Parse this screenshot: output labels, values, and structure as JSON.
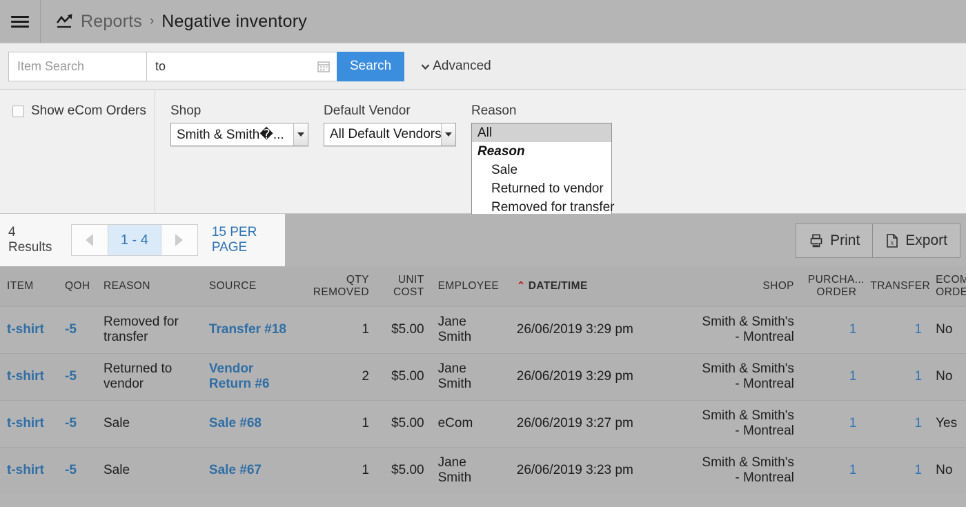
{
  "header": {
    "menu_icon": "hamburger-icon",
    "report_icon": "line-chart-icon",
    "breadcrumb_root": "Reports",
    "breadcrumb_sep": "›",
    "breadcrumb_current": "Negative inventory"
  },
  "search": {
    "item_placeholder": "Item Search",
    "item_value": "",
    "date_value": "to",
    "date_icon": "calendar-icon",
    "search_label": "Search",
    "advanced_label": "Advanced",
    "advanced_icon": "chevron-down-icon"
  },
  "filters": {
    "ecom_checkbox_label": "Show eCom Orders",
    "ecom_checked": false,
    "shop": {
      "label": "Shop",
      "value": "Smith & Smith�..."
    },
    "vendor": {
      "label": "Default Vendor",
      "value": "All Default Vendors"
    },
    "reason": {
      "label": "Reason",
      "selected": "All",
      "group_label": "Reason",
      "options": [
        "Sale",
        "Returned to vendor",
        "Removed for transfer"
      ]
    }
  },
  "toolbar": {
    "results_count": "4 Results",
    "prev_icon": "triangle-left-icon",
    "page_range": "1 - 4",
    "next_icon": "triangle-right-icon",
    "per_page": "15 PER PAGE",
    "print_label": "Print",
    "print_icon": "printer-icon",
    "export_label": "Export",
    "export_icon": "spreadsheet-file-icon"
  },
  "table": {
    "sort_column": "DATE/TIME",
    "sort_direction": "asc",
    "sort_caret": "⌃",
    "columns": [
      {
        "key": "item",
        "label": "ITEM",
        "align": "left"
      },
      {
        "key": "qoh",
        "label": "QOH",
        "align": "left"
      },
      {
        "key": "reason",
        "label": "REASON",
        "align": "left"
      },
      {
        "key": "source",
        "label": "SOURCE",
        "align": "left"
      },
      {
        "key": "qty_removed",
        "label": "QTY REMOVED",
        "align": "right"
      },
      {
        "key": "unit_cost",
        "label": "UNIT COST",
        "align": "right"
      },
      {
        "key": "employee",
        "label": "EMPLOYEE",
        "align": "left"
      },
      {
        "key": "datetime",
        "label": "DATE/TIME",
        "align": "left"
      },
      {
        "key": "shop",
        "label": "SHOP",
        "align": "right"
      },
      {
        "key": "purchase_order",
        "label": "PURCHA... ORDER",
        "align": "right"
      },
      {
        "key": "transfer",
        "label": "TRANSFER",
        "align": "right"
      },
      {
        "key": "ecom_order",
        "label": "ECOM ORDER",
        "align": "left"
      }
    ],
    "rows": [
      {
        "item": "t-shirt",
        "qoh": "-5",
        "reason": "Removed for transfer",
        "source": "Transfer #18",
        "qty_removed": "1",
        "unit_cost": "$5.00",
        "employee": "Jane Smith",
        "datetime": "26/06/2019 3:29 pm",
        "shop": "Smith & Smith's - Montreal",
        "purchase_order": "1",
        "transfer": "1",
        "ecom_order": "No"
      },
      {
        "item": "t-shirt",
        "qoh": "-5",
        "reason": "Returned to vendor",
        "source": "Vendor Return #6",
        "qty_removed": "2",
        "unit_cost": "$5.00",
        "employee": "Jane Smith",
        "datetime": "26/06/2019 3:29 pm",
        "shop": "Smith & Smith's - Montreal",
        "purchase_order": "1",
        "transfer": "1",
        "ecom_order": "No"
      },
      {
        "item": "t-shirt",
        "qoh": "-5",
        "reason": "Sale",
        "source": "Sale #68",
        "qty_removed": "1",
        "unit_cost": "$5.00",
        "employee": "eCom",
        "datetime": "26/06/2019 3:27 pm",
        "shop": "Smith & Smith's - Montreal",
        "purchase_order": "1",
        "transfer": "1",
        "ecom_order": "Yes"
      },
      {
        "item": "t-shirt",
        "qoh": "-5",
        "reason": "Sale",
        "source": "Sale #67",
        "qty_removed": "1",
        "unit_cost": "$5.00",
        "employee": "Jane Smith",
        "datetime": "26/06/2019 3:23 pm",
        "shop": "Smith & Smith's - Montreal",
        "purchase_order": "1",
        "transfer": "1",
        "ecom_order": "No"
      }
    ]
  },
  "colors": {
    "accent_blue": "#3b8edd",
    "link_blue": "#2f6ea5",
    "sort_red": "#b3261e",
    "header_gray": "#b5b5b5",
    "panel_gray": "#f0f0f0"
  }
}
